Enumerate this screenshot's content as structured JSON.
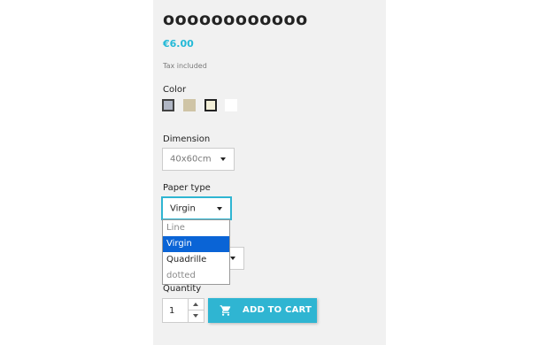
{
  "product": {
    "title": "oooooooooooo",
    "price": "€6.00",
    "tax_note": "Tax included"
  },
  "variants": {
    "color_label": "Color",
    "color_swatches": [
      {
        "name": "grey",
        "color": "#b0b6c4",
        "selected": true
      },
      {
        "name": "taupe",
        "color": "#cfc4a6",
        "selected": false
      },
      {
        "name": "off-white",
        "color": "#f3efd8",
        "selected": false
      },
      {
        "name": "white",
        "color": "#ffffff",
        "selected": false
      }
    ],
    "dimension_label": "Dimension",
    "dimension_value": "40x60cm",
    "paper_type_label": "Paper type",
    "paper_type_value": "Virgin",
    "paper_type_options": [
      {
        "label": "Line",
        "state": "disabled"
      },
      {
        "label": "Virgin",
        "state": "active"
      },
      {
        "label": "Quadrille",
        "state": "enabled"
      },
      {
        "label": "dotted",
        "state": "disabled"
      }
    ]
  },
  "cart": {
    "quantity_label": "Quantity",
    "quantity_value": "1",
    "add_to_cart_label": "ADD TO CART"
  },
  "colors": {
    "accent": "#2fb5d2",
    "price": "#24b9d7",
    "highlight": "#0a64d6"
  }
}
